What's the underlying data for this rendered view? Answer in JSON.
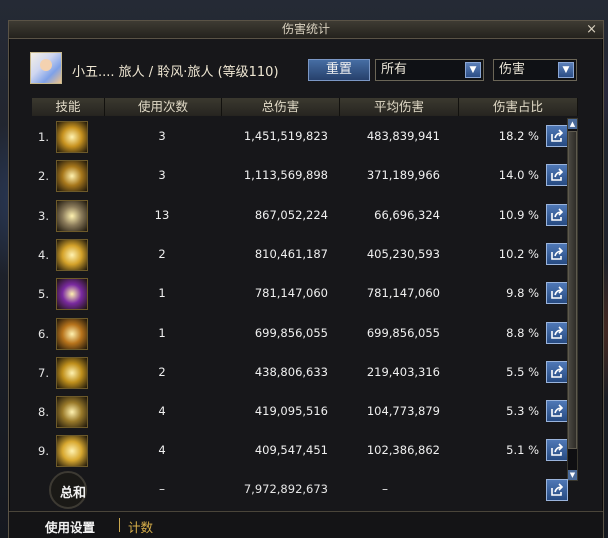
{
  "window": {
    "title": "伤害统计",
    "close": "×"
  },
  "character": {
    "name": "小五.... 旅人 / 聆风·旅人 (等级110)"
  },
  "controls": {
    "reset_label": "重置",
    "filter_value": "所有",
    "metric_value": "伤害",
    "dropdown_arrow": "▼"
  },
  "columns": [
    "技能",
    "使用次数",
    "总伤害",
    "平均伤害",
    "伤害占比"
  ],
  "rows": [
    {
      "idx": "1.",
      "uses": "3",
      "total": "1,451,519,823",
      "avg": "483,839,941",
      "pct": "18.2  %",
      "icon": "skill-icon-lightning-bolt",
      "color": "#c89320"
    },
    {
      "idx": "2.",
      "uses": "3",
      "total": "1,113,569,898",
      "avg": "371,189,966",
      "pct": "14.0  %",
      "icon": "skill-icon-arrow-strike",
      "color": "#a8781c"
    },
    {
      "idx": "3.",
      "uses": "13",
      "total": "867,052,224",
      "avg": "66,696,324",
      "pct": "10.9  %",
      "icon": "skill-icon-spear-thrust",
      "color": "#8a7a5a"
    },
    {
      "idx": "4.",
      "uses": "2",
      "total": "810,461,187",
      "avg": "405,230,593",
      "pct": "10.2  %",
      "icon": "skill-icon-golden-wave",
      "color": "#d4a22a"
    },
    {
      "idx": "5.",
      "uses": "1",
      "total": "781,147,060",
      "avg": "781,147,060",
      "pct": "9.8  %",
      "icon": "skill-icon-violet-slash",
      "color": "#7a2aa0"
    },
    {
      "idx": "6.",
      "uses": "1",
      "total": "699,856,055",
      "avg": "699,856,055",
      "pct": "8.8  %",
      "icon": "skill-icon-phoenix-arrow",
      "color": "#b8741c"
    },
    {
      "idx": "7.",
      "uses": "2",
      "total": "438,806,633",
      "avg": "219,403,316",
      "pct": "5.5  %",
      "icon": "skill-icon-golden-bow",
      "color": "#c0901c"
    },
    {
      "idx": "8.",
      "uses": "4",
      "total": "419,095,516",
      "avg": "104,773,879",
      "pct": "5.3  %",
      "icon": "skill-icon-scatter-shot",
      "color": "#9a7a2a"
    },
    {
      "idx": "9.",
      "uses": "4",
      "total": "409,547,451",
      "avg": "102,386,862",
      "pct": "5.1  %",
      "icon": "skill-icon-gold-blast",
      "color": "#d8a830"
    }
  ],
  "summary": {
    "label": "总和",
    "uses": "–",
    "total": "7,972,892,673",
    "avg": "–"
  },
  "footer": {
    "tab_settings": "使用设置",
    "tab_count": "计数"
  },
  "colors": {
    "accent_blue": "#3a5f98",
    "gold": "#d9b04a"
  }
}
